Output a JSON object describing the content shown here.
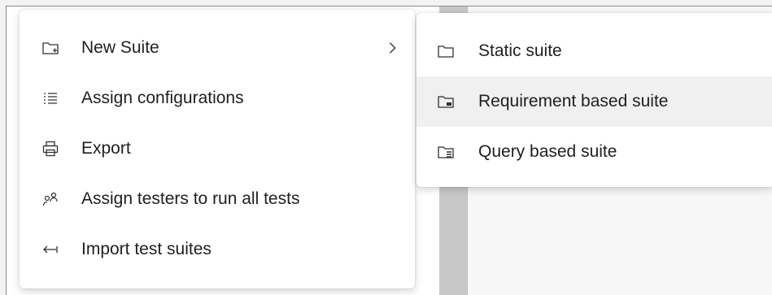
{
  "context_menu": {
    "items": [
      {
        "label": "New Suite",
        "icon": "new-suite-folder-icon",
        "has_submenu": true
      },
      {
        "label": "Assign configurations",
        "icon": "list-icon"
      },
      {
        "label": "Export",
        "icon": "printer-icon"
      },
      {
        "label": "Assign testers to run all tests",
        "icon": "people-icon"
      },
      {
        "label": "Import test suites",
        "icon": "import-arrow-icon"
      }
    ]
  },
  "submenu": {
    "items": [
      {
        "label": "Static suite",
        "icon": "folder-icon"
      },
      {
        "label": "Requirement based suite",
        "icon": "requirement-suite-icon"
      },
      {
        "label": "Query based suite",
        "icon": "query-suite-icon"
      }
    ],
    "hovered_index": 1
  },
  "colors": {
    "menu_background": "#ffffff",
    "hover_background": "#f0f0f0",
    "text": "#201f1e"
  }
}
